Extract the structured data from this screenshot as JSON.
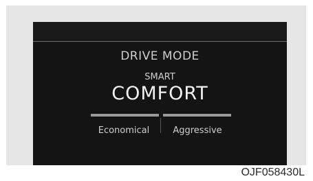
{
  "display": {
    "title": "DRIVE MODE",
    "mode_prefix": "SMART",
    "mode_value": "COMFORT",
    "bar": {
      "left_label": "Economical",
      "right_label": "Aggressive",
      "left_level": 1,
      "right_level": 1
    }
  },
  "caption": {
    "figure_code": "OJF058430L"
  },
  "colors": {
    "frame_background": "#e6e6e6",
    "screen_background": "#141414",
    "text_primary": "#f2f2f2",
    "text_secondary": "#cfcfcf",
    "bar_color": "#9a9a9a"
  }
}
